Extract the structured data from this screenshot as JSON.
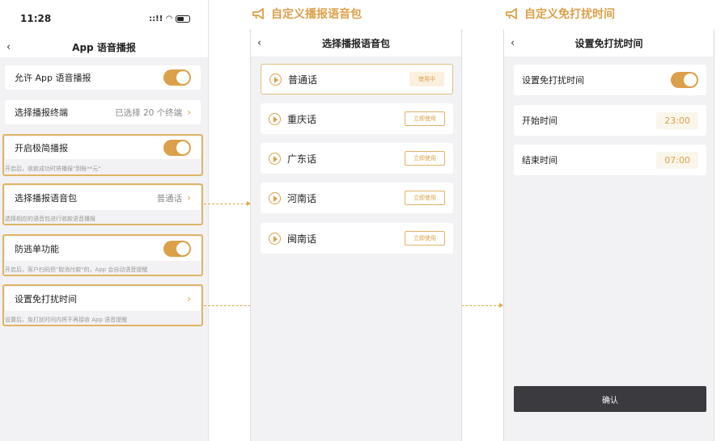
{
  "phone1": {
    "time": "11:28",
    "signal": "::!!",
    "nav_title": "App 语音播报",
    "rows": {
      "allow": {
        "label": "允许 App 语音播报"
      },
      "terminal": {
        "label": "选择播报终端",
        "value": "已选择 20 个终端"
      },
      "simple": {
        "label": "开启极简播报",
        "hint": "开启后，收款成功时将播报\"到账**元\""
      },
      "voice": {
        "label": "选择播报语音包",
        "value": "普通话",
        "hint": "选择相应的语音包进行收款语音播报"
      },
      "anti": {
        "label": "防逃单功能",
        "hint": "开启后，客户扫码但\"取消付款\"的，App 会自动语音提醒"
      },
      "dnd": {
        "label": "设置免打扰时间",
        "hint": "设置后，免打扰时间内将不再接收 App 语音提醒"
      }
    }
  },
  "phone2": {
    "header": "自定义播报语音包",
    "nav_title": "选择播报语音包",
    "voices": [
      {
        "name": "普通话",
        "button": "使用中"
      },
      {
        "name": "重庆话",
        "button": "立即使用"
      },
      {
        "name": "广东话",
        "button": "立即使用"
      },
      {
        "name": "河南话",
        "button": "立即使用"
      },
      {
        "name": "闽南话",
        "button": "立即使用"
      }
    ]
  },
  "phone3": {
    "header": "自定义免打扰时间",
    "nav_title": "设置免打扰时间",
    "dnd_label": "设置免打扰时间",
    "start_label": "开始时间",
    "start_value": "23:00",
    "end_label": "结束时间",
    "end_value": "07:00",
    "confirm": "确认"
  },
  "icons": {
    "back": "‹",
    "chevron": "›"
  },
  "colors": {
    "accent": "#dba049",
    "dark_button": "#3b3b3f"
  }
}
